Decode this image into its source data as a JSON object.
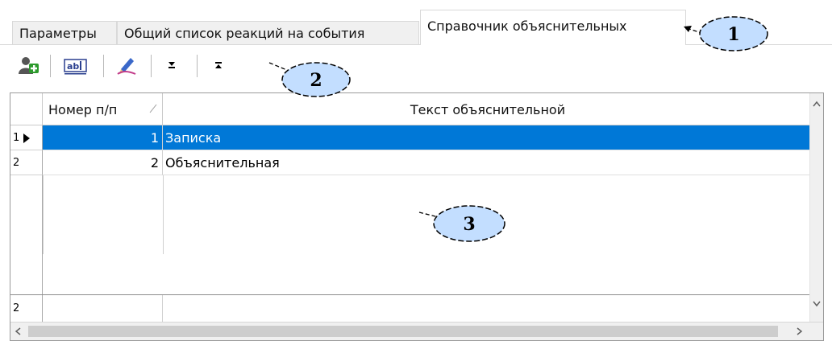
{
  "tabs": [
    {
      "label": "Параметры"
    },
    {
      "label": "Общий список реакций на события"
    },
    {
      "label": "Справочник объяснительных",
      "active": true
    }
  ],
  "toolbar": {
    "buttons": [
      {
        "icon": "add-icon"
      },
      {
        "icon": "rename-icon"
      },
      {
        "icon": "edit-icon"
      },
      {
        "icon": "move-down-icon"
      },
      {
        "icon": "move-up-icon"
      }
    ]
  },
  "grid": {
    "columns": [
      "Номер п/п",
      "Текст объяснительной"
    ],
    "rows": [
      {
        "indicator": "1",
        "number": "1",
        "text": "Записка",
        "selected": true
      },
      {
        "indicator": "2",
        "number": "2",
        "text": "Объяснительная",
        "selected": false
      }
    ],
    "footer_indicator": "2"
  },
  "callouts": [
    "1",
    "2",
    "3"
  ],
  "colors": {
    "selection": "#0078d7",
    "callout_fill": "#c3deff"
  }
}
